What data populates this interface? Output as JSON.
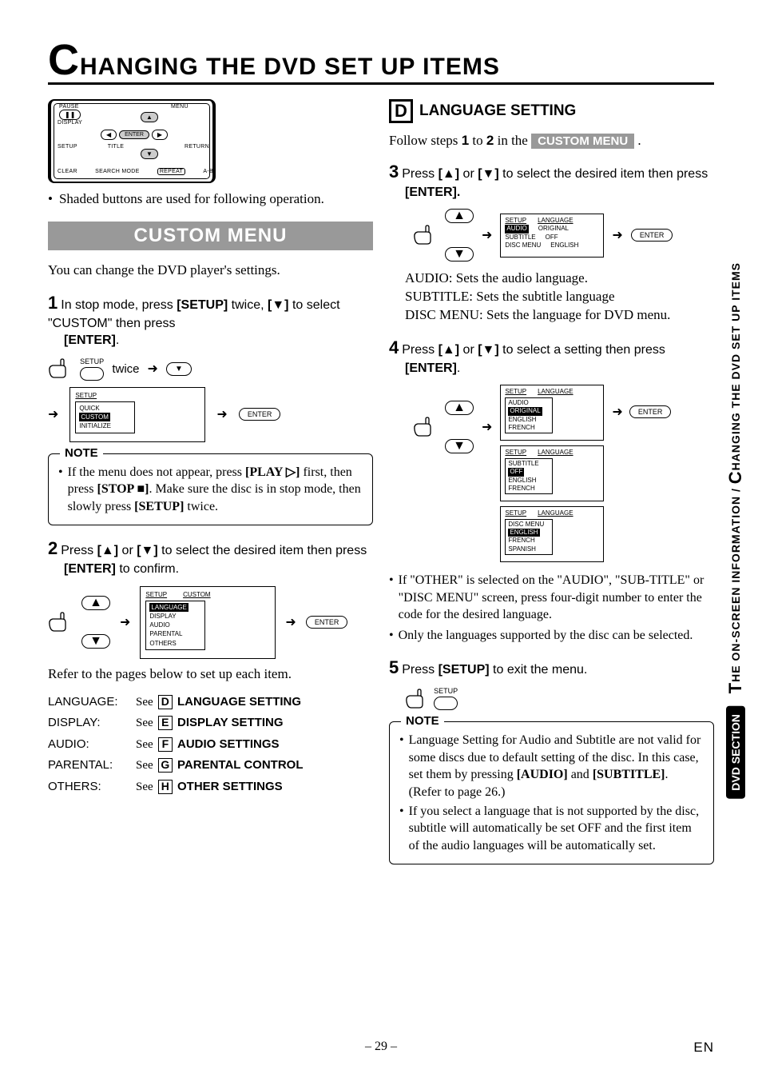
{
  "chapter": {
    "cap": "C",
    "rest": "HANGING THE DVD SET UP ITEMS"
  },
  "remote": {
    "pause": "PAUSE",
    "menu": "MENU",
    "display": "DISPLAY",
    "enter": "ENTER",
    "setup": "SETUP",
    "title": "TITLE",
    "return": "RETURN",
    "clear": "CLEAR",
    "search": "SEARCH MODE",
    "repeat": "REPEAT",
    "ab": "A-B"
  },
  "shaded_note": "Shaded buttons are used for following operation.",
  "custom_menu": {
    "title": "CUSTOM MENU",
    "intro": "You can change the DVD player's settings.",
    "step1_a": "In stop mode, press ",
    "step1_b": "[SETUP]",
    "step1_c": " twice, ",
    "step1_d": "[▼]",
    "step1_e": " to select \"CUSTOM\" then press ",
    "step1_f": "[ENTER]",
    "step1_g": ".",
    "setup_label": "SETUP",
    "twice": "twice",
    "enter_btn": "ENTER",
    "menu_screen": {
      "hdr": "SETUP",
      "items": [
        "QUICK",
        "CUSTOM",
        "INITIALIZE"
      ],
      "highlighted": "CUSTOM"
    },
    "note_label": "NOTE",
    "note1_a": "If the menu does not appear, press ",
    "note1_b": "[PLAY ▷]",
    "note1_c": " first, then press ",
    "note1_d": "[STOP ■]",
    "note1_e": ". Make sure the disc is in stop mode, then slowly press ",
    "note1_f": "[SETUP]",
    "note1_g": " twice.",
    "step2_a": "Press ",
    "step2_b": "[▲]",
    "step2_c": " or ",
    "step2_d": "[▼]",
    "step2_e": " to select the desired item then press ",
    "step2_f": "[ENTER]",
    "step2_g": " to confirm.",
    "custom_screen": {
      "hdr1": "SETUP",
      "hdr2": "CUSTOM",
      "items": [
        "LANGUAGE",
        "DISPLAY",
        "AUDIO",
        "PARENTAL",
        "OTHERS"
      ],
      "highlighted": "LANGUAGE"
    },
    "refer": "Refer to the pages below to set up each item.",
    "refs": [
      {
        "k": "LANGUAGE:",
        "see": "See",
        "l": "D",
        "t": "LANGUAGE SETTING"
      },
      {
        "k": "DISPLAY:",
        "see": "See",
        "l": "E",
        "t": "DISPLAY SETTING"
      },
      {
        "k": "AUDIO:",
        "see": "See",
        "l": "F",
        "t": "AUDIO SETTINGS"
      },
      {
        "k": "PARENTAL:",
        "see": "See",
        "l": "G",
        "t": "PARENTAL CONTROL"
      },
      {
        "k": "OTHERS:",
        "see": "See",
        "l": "H",
        "t": "OTHER SETTINGS"
      }
    ]
  },
  "lang": {
    "letter": "D",
    "title": "LANGUAGE SETTING",
    "follow_a": "Follow steps ",
    "follow_b": "1",
    "follow_c": " to ",
    "follow_d": "2",
    "follow_e": " in the ",
    "follow_tag": "CUSTOM MENU",
    "follow_f": " .",
    "step3_a": "Press ",
    "step3_b": "[▲]",
    "step3_c": " or ",
    "step3_d": "[▼]",
    "step3_e": " to select the desired item then press ",
    "step3_f": "[ENTER].",
    "screen3": {
      "hdr1": "SETUP",
      "hdr2": "LANGUAGE",
      "rows": [
        {
          "a": "AUDIO",
          "b": "ORIGINAL"
        },
        {
          "a": "SUBTITLE",
          "b": "OFF"
        },
        {
          "a": "DISC MENU",
          "b": "ENGLISH"
        }
      ],
      "highlighted": "AUDIO"
    },
    "desc_audio": "AUDIO: Sets the audio language.",
    "desc_sub": "SUBTITLE: Sets the subtitle language",
    "desc_disc": "DISC MENU: Sets the language for DVD menu.",
    "step4_a": "Press ",
    "step4_b": "[▲]",
    "step4_c": " or ",
    "step4_d": "[▼]",
    "step4_e": " to select a setting then press ",
    "step4_f": "[ENTER]",
    "step4_g": ".",
    "screen4a": {
      "hdr1": "SETUP",
      "hdr2": "LANGUAGE",
      "t": "AUDIO",
      "items": [
        "ORIGINAL",
        "ENGLISH",
        "FRENCH"
      ],
      "hl": "ORIGINAL"
    },
    "screen4b": {
      "hdr1": "SETUP",
      "hdr2": "LANGUAGE",
      "t": "SUBTITLE",
      "items": [
        "OFF",
        "ENGLISH",
        "FRENCH"
      ],
      "hl": "OFF"
    },
    "screen4c": {
      "hdr1": "SETUP",
      "hdr2": "LANGUAGE",
      "t": "DISC MENU",
      "items": [
        "ENGLISH",
        "FRENCH",
        "SPANISH"
      ],
      "hl": "ENGLISH"
    },
    "bul1": "If \"OTHER\" is selected on the \"AUDIO\", \"SUB-TITLE\" or \"DISC MENU\" screen, press four-digit number to enter the code for the desired language.",
    "bul2": "Only the languages supported by the disc can be selected.",
    "step5_a": "Press ",
    "step5_b": "[SETUP]",
    "step5_c": " to exit the menu.",
    "note2_a": "Language Setting for Audio and Subtitle are not valid for some discs due to default setting of the disc. In this case, set them by pressing ",
    "note2_b": "[AUDIO]",
    "note2_c": " and ",
    "note2_d": "[SUBTITLE]",
    "note2_e": ". (Refer to page 26.)",
    "note2_f": "If you select a language that is not supported by the disc, subtitle will automatically be set OFF and the first item of the audio languages will be automatically set."
  },
  "side": {
    "long_a": "T",
    "long_b": "HE ON-SCREEN INFORMATION / ",
    "long_c": "C",
    "long_d": "HANGING THE DVD SET UP ITEMS",
    "pill": "DVD SECTION"
  },
  "footer": {
    "page": "– 29 –",
    "en": "EN"
  }
}
